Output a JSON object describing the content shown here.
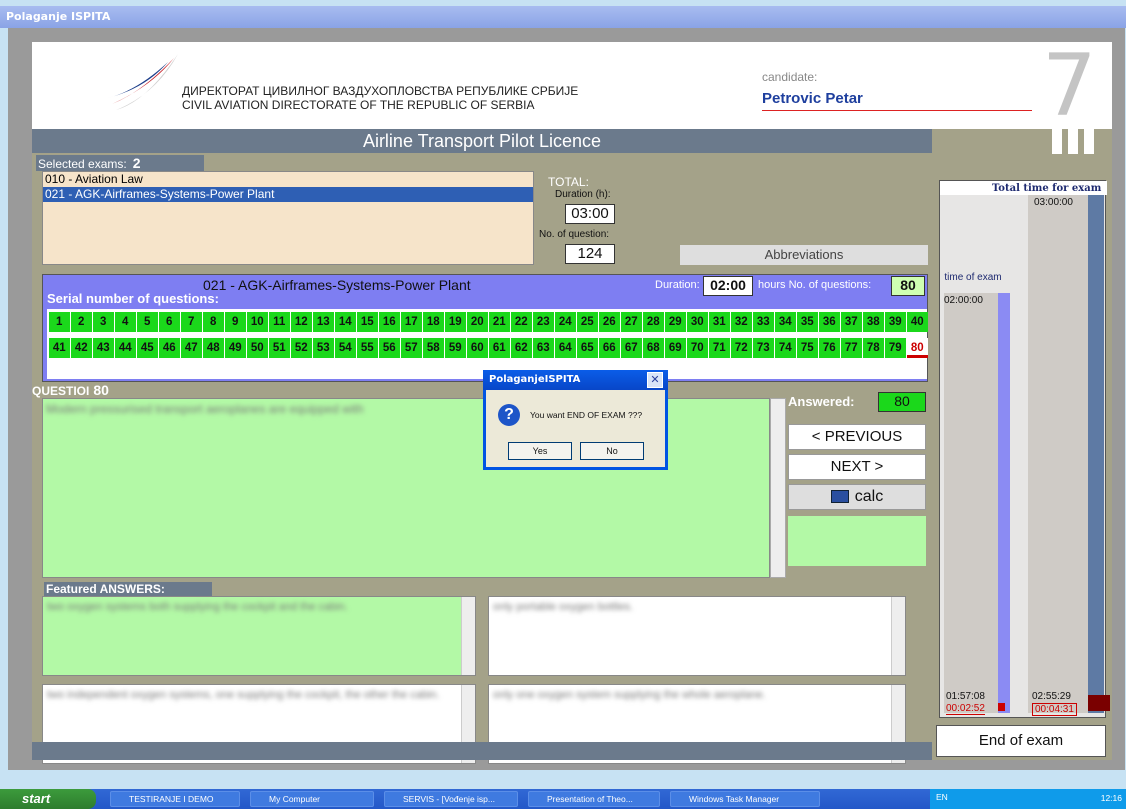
{
  "window": {
    "title": "Polaganje ISPITA"
  },
  "header": {
    "org_sr": "ДИРЕКТОРАТ ЦИВИЛНОГ ВАЗДУХОПЛОВСТВА РЕПУБЛИКЕ СРБИЈЕ",
    "org_en": "CIVIL AVIATION DIRECTORATE OF THE REPUBLIC OF SERBIA",
    "candidate_label": "candidate:",
    "candidate_name": "Petrovic Petar",
    "big_number": "7",
    "licence": "Airline Transport Pilot Licence"
  },
  "selected": {
    "label": "Selected exams:",
    "count": "2",
    "items": [
      "010 - Aviation Law",
      "021 - AGK-Airframes-Systems-Power Plant"
    ],
    "total_label": "TOTAL:",
    "duration_label": "Duration (h):",
    "duration": "03:00",
    "noq_label": "No. of question:",
    "noq": "124",
    "abbrev": "Abbreviations"
  },
  "qpanel": {
    "title": "021 - AGK-Airframes-Systems-Power Plant",
    "serial_label": "Serial number of questions:",
    "duration_label": "Duration:",
    "duration": "02:00",
    "hours_label": "hours No. of questions:",
    "noq": "80",
    "current": 80,
    "total": 80
  },
  "question": {
    "label": "QUESTIOI",
    "number": "80",
    "text": "Modern pressurised transport aeroplanes are equipped with",
    "answered_label": "Answered:",
    "answered": "80",
    "prev": "< PREVIOUS",
    "next": "NEXT   >",
    "calc": "calc"
  },
  "answers": {
    "label": "Featured ANSWERS:",
    "a1": "two oxygen systems both supplying the cockpit and the cabin.",
    "a2": "only portable oxygen bottles.",
    "a3": "two independent oxygen systems, one supplying the cockpit, the other the cabin.",
    "a4": "only one oxygen system supplying the whole aeroplane."
  },
  "timer": {
    "total_label": "Total time for exam",
    "total_value": "03:00:00",
    "exam_label": "time of exam",
    "exam_value": "02:00:00",
    "exam_remaining": "01:57:08",
    "exam_used": "00:02:52",
    "total_remaining": "02:55:29",
    "total_used": "00:04:31"
  },
  "end_button": "End of exam",
  "dialog": {
    "title": "PolaganjeISPITA",
    "message": "You want END OF EXAM ???",
    "yes": "Yes",
    "no": "No",
    "close": "✕",
    "icon": "?"
  },
  "taskbar": {
    "start": "start",
    "items": [
      "TESTIRANJE I DEMO",
      "My Computer",
      "SERVIS - [Vođenje isp...",
      "Presentation of Theo...",
      "Windows Task Manager"
    ],
    "lang": "EN",
    "clock": "12:16"
  },
  "colors": {
    "accent": "#7e7ef2",
    "green": "#1bd81b",
    "panel": "#a4a289",
    "header_strip": "#6b7a8c"
  }
}
